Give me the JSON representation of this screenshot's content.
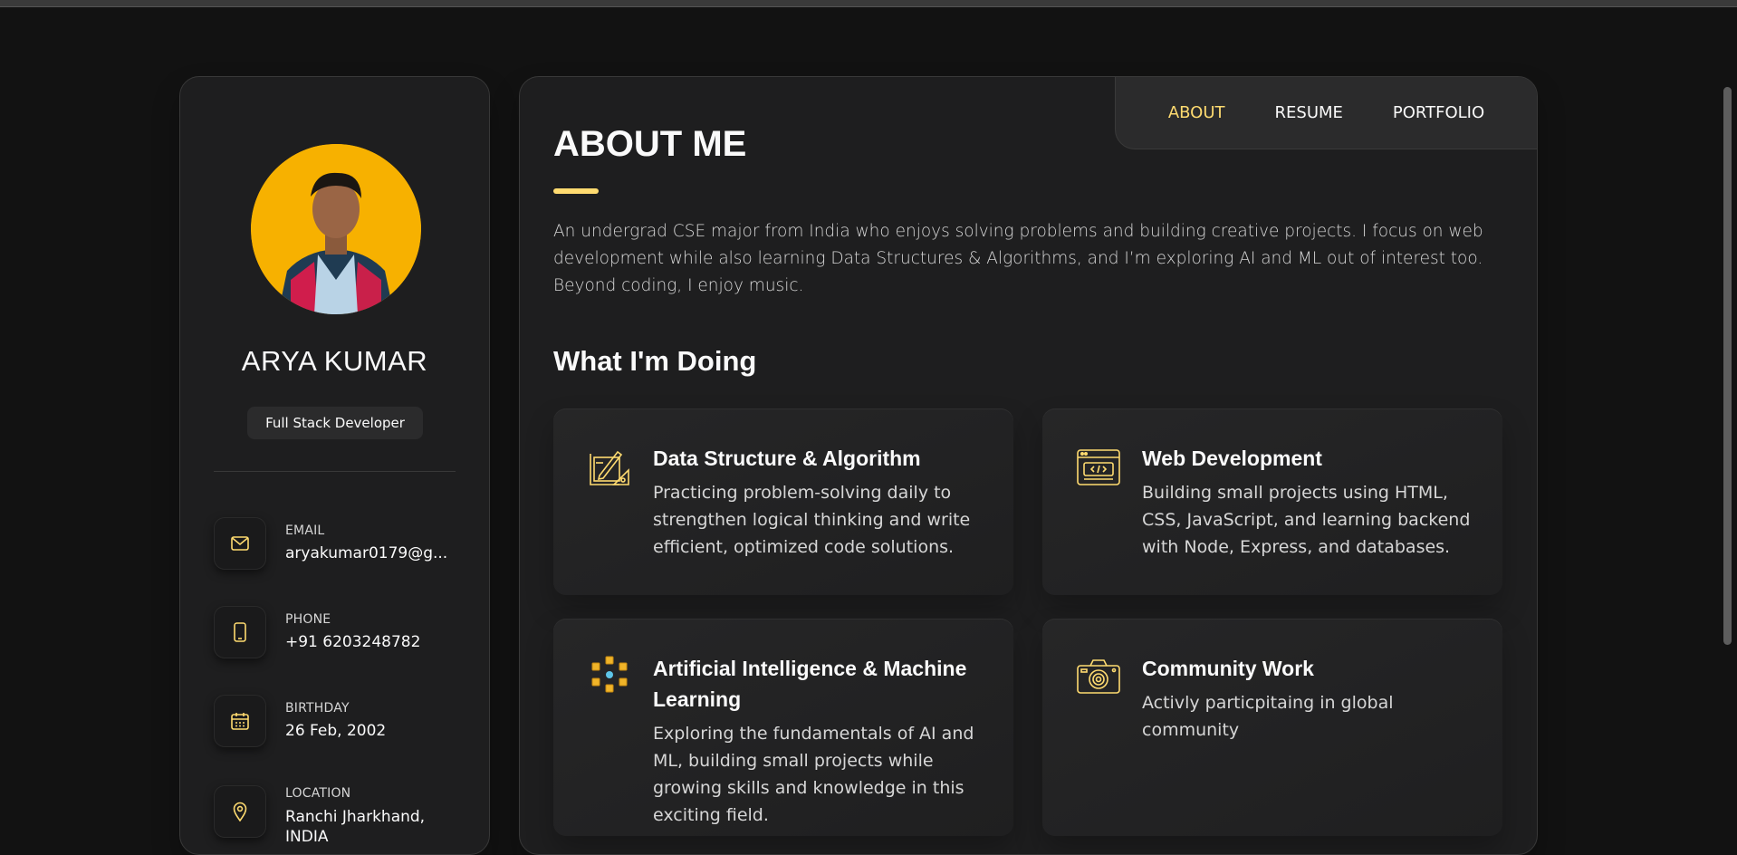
{
  "profile": {
    "name": "ARYA KUMAR",
    "role": "Full Stack Developer",
    "avatar_bg": "#f7b100"
  },
  "contacts": [
    {
      "label": "EMAIL",
      "value": "aryakumar0179@g...",
      "icon": "mail-icon"
    },
    {
      "label": "PHONE",
      "value": "+91 6203248782",
      "icon": "phone-icon"
    },
    {
      "label": "BIRTHDAY",
      "value": "26 Feb, 2002",
      "icon": "calendar-icon"
    },
    {
      "label": "LOCATION",
      "value": "Ranchi Jharkhand, INDIA",
      "icon": "location-pin-icon"
    }
  ],
  "nav": {
    "items": [
      "ABOUT",
      "RESUME",
      "PORTFOLIO"
    ],
    "active": "ABOUT"
  },
  "about": {
    "heading": "ABOUT ME",
    "text": "An undergrad CSE major from India who enjoys solving problems and building creative projects. I focus on web development while also learning Data Structures & Algorithms, and I’m exploring AI and ML out of interest too. Beyond coding, I enjoy music."
  },
  "doing": {
    "heading": "What I'm Doing",
    "services": [
      {
        "title": "Data Structure & Algorithm",
        "text": "Practicing problem-solving daily to strengthen logical thinking and write efficient, optimized code solutions.",
        "icon": "design-tools-icon"
      },
      {
        "title": "Web Development",
        "text": "Building small projects using HTML, CSS, JavaScript, and learning backend with Node, Express, and databases.",
        "icon": "code-window-icon"
      },
      {
        "title": "Artificial Intelligence & Machine Learning",
        "text": "Exploring the fundamentals of AI and ML, building small projects while growing skills and knowledge in this exciting field.",
        "icon": "ai-network-icon"
      },
      {
        "title": "Community Work",
        "text": "Activly particpitaing in global community",
        "icon": "camera-icon"
      }
    ]
  },
  "colors": {
    "accent": "#ffdb70",
    "background": "#121212",
    "panel": "#1e1e1f"
  }
}
